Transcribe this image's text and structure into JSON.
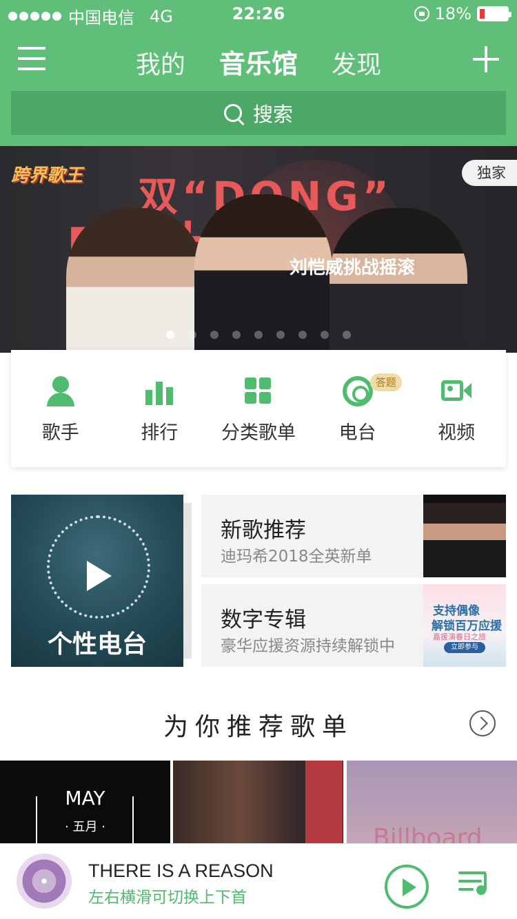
{
  "status_bar": {
    "carrier": "中国电信",
    "network": "4G",
    "time": "22:26",
    "battery": "18%",
    "battery_level": 0.18
  },
  "header": {
    "tabs": [
      "我的",
      "音乐馆",
      "发现"
    ],
    "active_tab": "音乐馆",
    "search_placeholder": "搜索"
  },
  "banner": {
    "logo": "跨界歌王",
    "badge": "独家",
    "headline_1": "双“DONG”",
    "headline_2": "PK大战",
    "subline": "刘恺威挑战摇滚",
    "slide_count": 9,
    "active_slide": 1
  },
  "categories": [
    {
      "label": "歌手",
      "icon": "singer-icon"
    },
    {
      "label": "排行",
      "icon": "chart-bars-icon"
    },
    {
      "label": "分类歌单",
      "icon": "grid-icon"
    },
    {
      "label": "电台",
      "icon": "radio-icon",
      "badge": "答题"
    },
    {
      "label": "视频",
      "icon": "video-icon"
    }
  ],
  "features": {
    "personal_radio": "个性电台",
    "new_songs": {
      "title": "新歌推荐",
      "subtitle": "迪玛希2018全英新单"
    },
    "digital_album": {
      "title": "数字专辑",
      "subtitle": "豪华应援资源持续解锁中",
      "thumb_line1": "支持偶像",
      "thumb_line2": "解锁百万应援",
      "thumb_line3": "嘉援演春日之旅",
      "thumb_button": "立即参与"
    }
  },
  "recommend": {
    "title": "为你推荐歌单",
    "playlists": [
      {
        "text": "MAY",
        "sub": "· 五月 ·"
      },
      {
        "text": "",
        "sub": ""
      },
      {
        "text": "Billboard",
        "sub": ""
      }
    ]
  },
  "player": {
    "song": "THERE IS A REASON",
    "hint": "左右横滑可切换上下首"
  },
  "colors": {
    "brand_green": "#5fbf78",
    "search_bg": "#4ca866",
    "accent_green": "#4fbb6e"
  }
}
